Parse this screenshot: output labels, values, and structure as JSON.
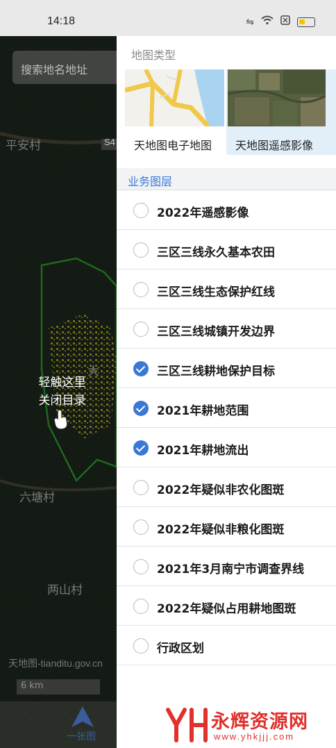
{
  "status_bar": {
    "time": "14:18",
    "icons": [
      "vibrate-icon",
      "wifi-icon",
      "sim-icon",
      "battery-icon"
    ],
    "battery_color": "#f5c400",
    "battery_level": 0.4
  },
  "map": {
    "search_placeholder": "搜索地名地址",
    "place_labels": [
      "平安村",
      "六塘村",
      "两山村",
      "大"
    ],
    "road_sign": "S4",
    "hint_line1": "轻触这里",
    "hint_line2": "关闭目录",
    "attribution": "天地图-tianditu.gov.cn",
    "scale_label": "6 km",
    "nav_label": "一张图",
    "accent_color": "#3b5b9a"
  },
  "drawer": {
    "basemap_title": "地图类型",
    "basemaps": [
      {
        "label": "天地图电子地图",
        "selected": false
      },
      {
        "label": "天地图遥感影像",
        "selected": true
      }
    ],
    "layers_title": "业务图层",
    "accent_color": "#3a78d6",
    "layers": [
      {
        "label": "2022年遥感影像",
        "checked": false
      },
      {
        "label": "三区三线永久基本农田",
        "checked": false
      },
      {
        "label": "三区三线生态保护红线",
        "checked": false
      },
      {
        "label": "三区三线城镇开发边界",
        "checked": false
      },
      {
        "label": "三区三线耕地保护目标",
        "checked": true
      },
      {
        "label": "2021年耕地范围",
        "checked": true
      },
      {
        "label": "2021年耕地流出",
        "checked": true
      },
      {
        "label": "2022年疑似非农化图斑",
        "checked": false
      },
      {
        "label": "2022年疑似非粮化图斑",
        "checked": false
      },
      {
        "label": "2021年3月南宁市调查界线",
        "checked": false
      },
      {
        "label": "2022年疑似占用耕地图斑",
        "checked": false
      },
      {
        "label": "行政区划",
        "checked": false
      }
    ]
  },
  "watermark": {
    "name": "永辉资源网",
    "url": "www.yhkjjj.com",
    "color": "#e0312c"
  }
}
